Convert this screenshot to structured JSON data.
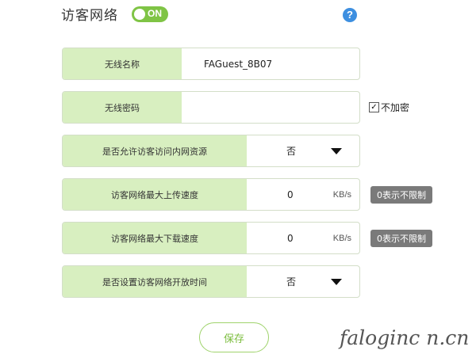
{
  "header": {
    "title": "访客网络",
    "toggle_label": "ON",
    "help_icon": "question-icon"
  },
  "form": {
    "ssid": {
      "label": "无线名称",
      "value": "FAGuest_8B07"
    },
    "password": {
      "label": "无线密码",
      "value": "",
      "no_encrypt_label": "不加密",
      "no_encrypt_checked": true
    },
    "intranet_access": {
      "label": "是否允许访客访问内网资源",
      "value": "否"
    },
    "upload_speed": {
      "label": "访客网络最大上传速度",
      "value": "0",
      "unit": "KB/s",
      "hint": "0表示不限制"
    },
    "download_speed": {
      "label": "访客网络最大下载速度",
      "value": "0",
      "unit": "KB/s",
      "hint": "0表示不限制"
    },
    "open_time": {
      "label": "是否设置访客网络开放时间",
      "value": "否"
    }
  },
  "actions": {
    "save_label": "保存"
  },
  "watermark": "faloginc n.cn",
  "colors": {
    "accent": "#7fc445",
    "label_bg": "#d8efc0",
    "hint_bg": "#7a7a7a",
    "help_blue": "#3d8fe0"
  }
}
